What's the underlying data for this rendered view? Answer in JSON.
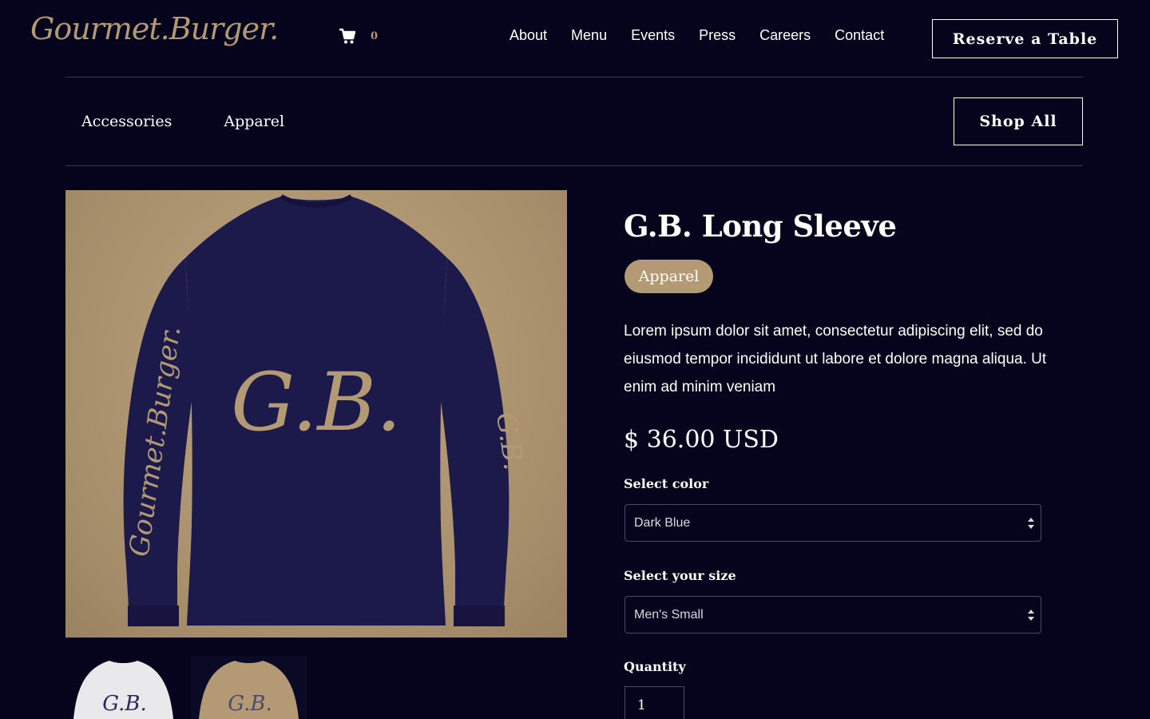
{
  "brand": {
    "logo_text": "Gourmet.Burger."
  },
  "cart": {
    "icon": "cart-icon",
    "count": "0"
  },
  "nav": {
    "items": [
      {
        "label": "About"
      },
      {
        "label": "Menu"
      },
      {
        "label": "Events"
      },
      {
        "label": "Press"
      },
      {
        "label": "Careers"
      },
      {
        "label": "Contact"
      }
    ],
    "reserve_label": "Reserve a Table"
  },
  "categories": {
    "items": [
      {
        "label": "Accessories"
      },
      {
        "label": "Apparel"
      }
    ],
    "shop_all_label": "Shop All"
  },
  "product": {
    "title": "G.B. Long Sleeve",
    "category_badge": "Apparel",
    "description": "Lorem ipsum dolor sit amet, consectetur adipiscing elit, sed do eiusmod tempor incididunt ut labore et dolore magna aliqua. Ut enim ad minim veniam",
    "price": "$ 36.00 USD",
    "image_monogram": "G.B.",
    "image_sleeve_text": "Gourmet.Burger.",
    "thumb_monogram": "G.B.",
    "color_label": "Select color",
    "color_value": "Dark Blue",
    "size_label": "Select your size",
    "size_value": "Men's Small",
    "quantity_label": "Quantity",
    "quantity_value": "1"
  },
  "colors": {
    "background": "#05041c",
    "accent": "#b39a74",
    "shirt_navy": "#1c1a4a",
    "image_background": "#b09775"
  }
}
